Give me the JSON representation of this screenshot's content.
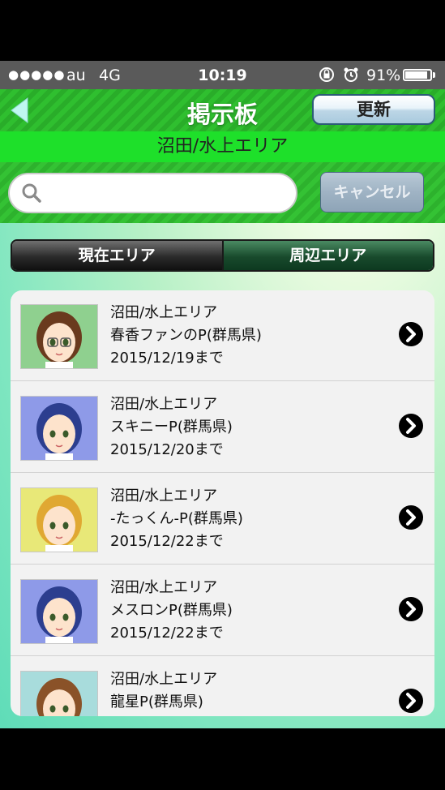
{
  "status": {
    "dots": "●●●●●",
    "carrier": "au",
    "network": "4G",
    "time": "10:19",
    "battery": "91%",
    "battery_level": 0.91
  },
  "nav": {
    "title": "掲示板",
    "refresh_label": "更新"
  },
  "area_title": "沼田/水上エリア",
  "search": {
    "placeholder": "",
    "value": "",
    "cancel_label": "キャンセル"
  },
  "tabs": [
    {
      "label": "現在エリア",
      "active": true
    },
    {
      "label": "周辺エリア",
      "active": false
    }
  ],
  "posts": [
    {
      "area": "沼田/水上エリア",
      "name": "春香ファンのP(群馬県)",
      "until": "2015/12/19まで",
      "avatar": "brown-hair-glasses",
      "bg": "#8fd08f"
    },
    {
      "area": "沼田/水上エリア",
      "name": "スキニーP(群馬県)",
      "until": "2015/12/20まで",
      "avatar": "blue-hair",
      "bg": "#8e9ae8"
    },
    {
      "area": "沼田/水上エリア",
      "name": "-たっくん-P(群馬県)",
      "until": "2015/12/22まで",
      "avatar": "blonde-hair",
      "bg": "#e8e878"
    },
    {
      "area": "沼田/水上エリア",
      "name": "メスロンP(群馬県)",
      "until": "2015/12/22まで",
      "avatar": "blue-hair",
      "bg": "#8e9ae8"
    },
    {
      "area": "沼田/水上エリア",
      "name": "龍星P(群馬県)",
      "until": "",
      "avatar": "brown-hair",
      "bg": "#a8dcdc"
    }
  ]
}
